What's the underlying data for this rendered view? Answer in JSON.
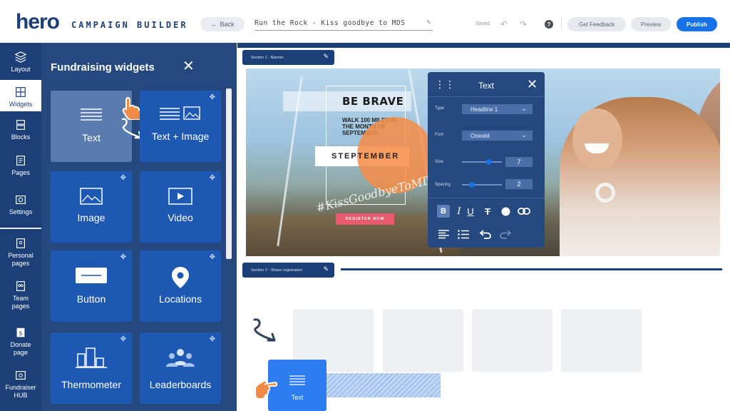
{
  "brand": {
    "logo_text": "hero",
    "product_name": "CAMPAIGN BUILDER"
  },
  "header": {
    "back_label": "Back",
    "campaign_title": "Run the Rock - Kiss goodbye to MDS",
    "saved_label": "Saved",
    "feedback_label": "Get Feedback",
    "preview_label": "Preview",
    "publish_label": "Publish",
    "accent_color": "#1672e6"
  },
  "sidebar": {
    "items": [
      {
        "label": "Layout",
        "icon": "layers-icon"
      },
      {
        "label": "Widgets",
        "icon": "grid-icon",
        "active": true
      },
      {
        "label": "Blocks",
        "icon": "blocks-icon"
      },
      {
        "label": "Pages",
        "icon": "pages-icon"
      },
      {
        "label": "Settings",
        "icon": "settings-icon"
      },
      {
        "label": "Personal pages",
        "icon": "personal-page-icon"
      },
      {
        "label": "Team pages",
        "icon": "team-page-icon"
      },
      {
        "label": "Donate page",
        "icon": "donate-icon"
      },
      {
        "label": "Fundraiser HUB",
        "icon": "hub-icon"
      }
    ]
  },
  "widgets_panel": {
    "title": "Fundraising widgets",
    "widgets": [
      {
        "label": "Text",
        "icon": "text-lines-icon",
        "selected": true
      },
      {
        "label": "Text + Image",
        "icon": "text-image-icon"
      },
      {
        "label": "Image",
        "icon": "image-icon"
      },
      {
        "label": "Video",
        "icon": "video-icon"
      },
      {
        "label": "Button",
        "icon": "button-icon"
      },
      {
        "label": "Locations",
        "icon": "location-pin-icon"
      },
      {
        "label": "Thermometer",
        "icon": "thermometer-icon"
      },
      {
        "label": "Leaderboards",
        "icon": "leaderboard-icon"
      }
    ]
  },
  "canvas": {
    "section1_label": "Section 1 - Banner",
    "section2_label": "Section 2 - Shave registration",
    "banner": {
      "headline": "BE BRAVE",
      "subline": "WALK 100 MILES IN THE MONTH OF SEPTEMBER.",
      "step_text": "STEPTEMBER",
      "hashtag": "#KissGoodbyeToMDS",
      "register_label": "REGISTER NOW"
    },
    "drag_tile_label": "Text"
  },
  "text_popup": {
    "title": "Text",
    "type_label": "Type",
    "type_value": "Headline 1",
    "font_label": "Font",
    "font_value": "Oswald",
    "size_label": "Size",
    "size_value": "7",
    "spacing_label": "Spacing",
    "spacing_value": "2",
    "size_slider_fraction": 0.7,
    "spacing_slider_fraction": 0.2
  }
}
